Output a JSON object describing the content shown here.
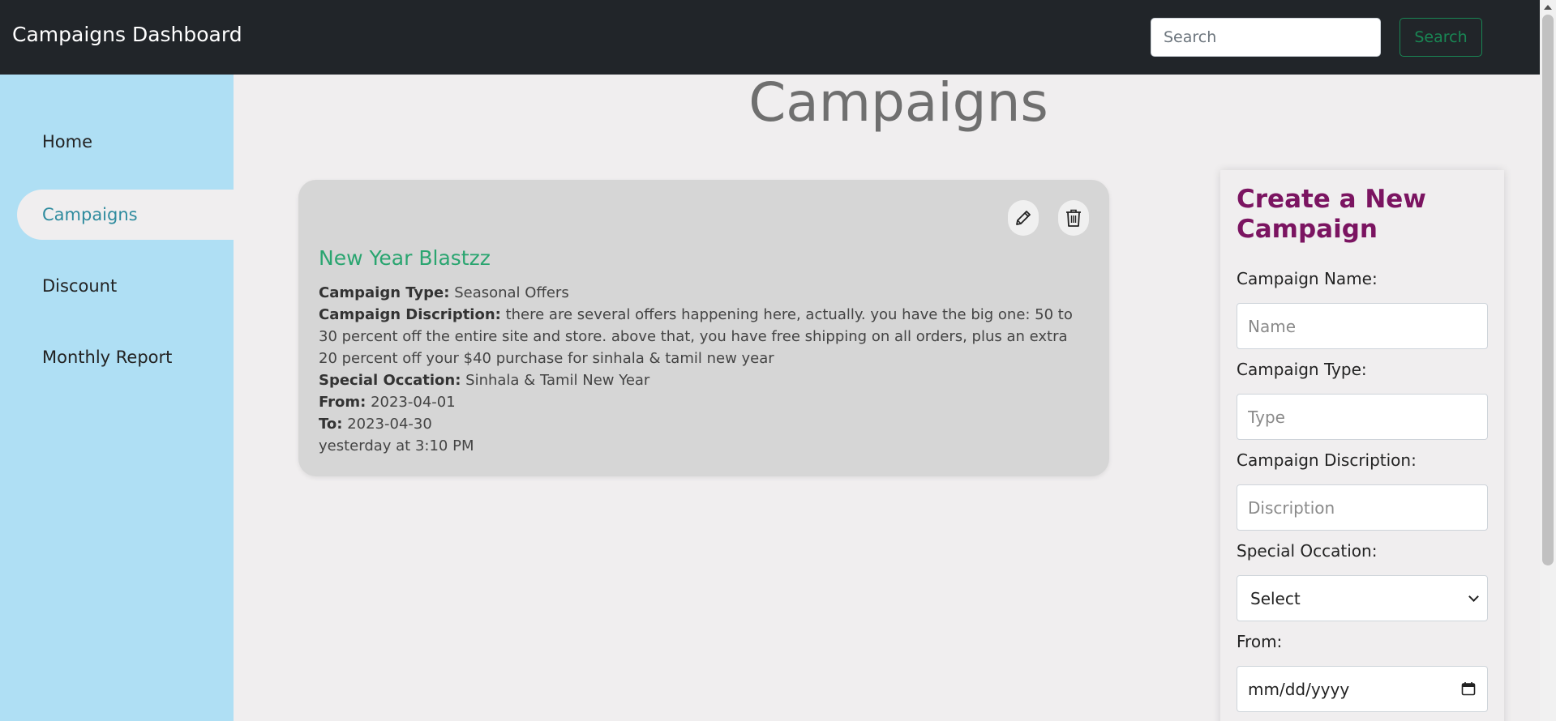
{
  "header": {
    "brand": "Campaigns Dashboard",
    "search_placeholder": "Search",
    "search_button": "Search"
  },
  "sidebar": {
    "items": [
      {
        "label": "Home",
        "active": false
      },
      {
        "label": "Campaigns",
        "active": true
      },
      {
        "label": "Discount",
        "active": false
      },
      {
        "label": "Monthly Report",
        "active": false
      }
    ]
  },
  "main": {
    "title": "Campaigns"
  },
  "campaign": {
    "title": "New Year Blastzz",
    "type_label": "Campaign Type:",
    "type_value": "Seasonal Offers",
    "description_label": "Campaign Discription:",
    "description_value": "there are several offers happening here, actually. you have the big one: 50 to 30 percent off the entire site and store. above that, you have free shipping on all orders, plus an extra 20 percent off your $40 purchase for sinhala & tamil new year",
    "occasion_label": "Special Occation:",
    "occasion_value": "Sinhala & Tamil New Year",
    "from_label": "From:",
    "from_value": "2023-04-01",
    "to_label": "To:",
    "to_value": "2023-04-30",
    "timestamp": "yesterday at 3:10 PM",
    "edit_icon": "pencil-icon",
    "delete_icon": "trash-icon"
  },
  "form": {
    "title": "Create a New Campaign",
    "name_label": "Campaign Name:",
    "name_placeholder": "Name",
    "type_label": "Campaign Type:",
    "type_placeholder": "Type",
    "description_label": "Campaign Discription:",
    "description_placeholder": "Discription",
    "occasion_label": "Special Occation:",
    "occasion_selected": "Select",
    "from_label": "From:",
    "from_value": "mm/dd/yyyy"
  },
  "colors": {
    "topbar": "#212529",
    "sidebar": "#afdff4",
    "accent_teal": "#2e8b9e",
    "campaign_title": "#2aa570",
    "form_title": "#7b1461",
    "search_button": "#198754"
  }
}
